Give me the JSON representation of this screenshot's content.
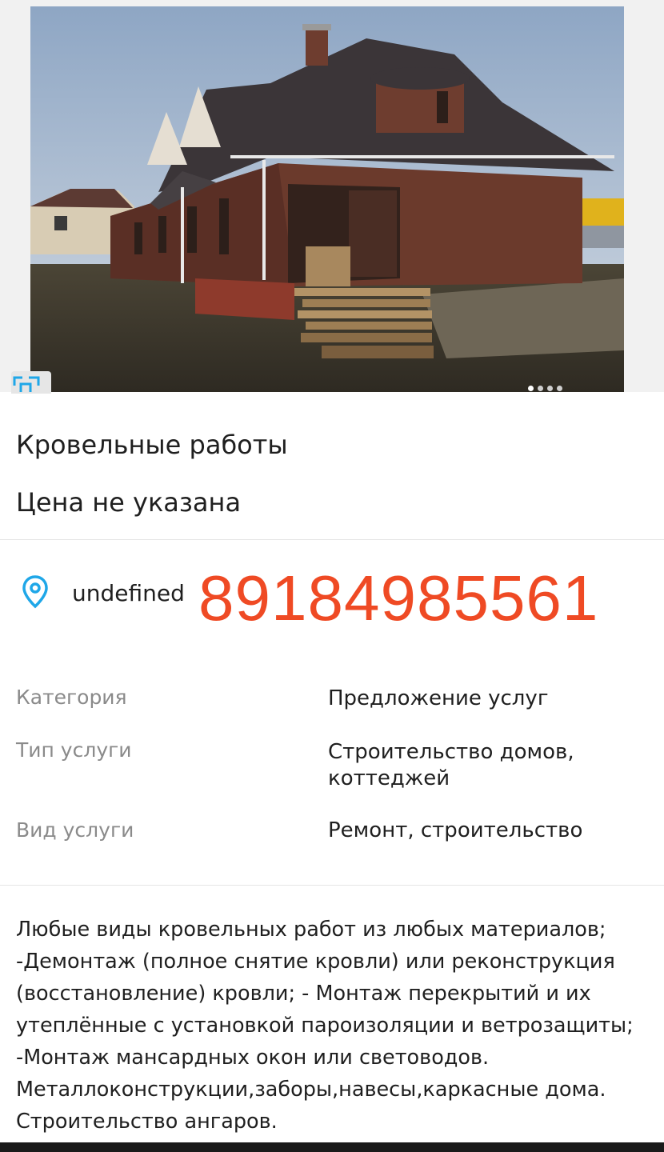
{
  "listing": {
    "title": "Кровельные работы",
    "price": "Цена не указана",
    "location": "undefined",
    "phone": "89184985561",
    "gallery": {
      "photo_count": 4,
      "active_index": 0
    }
  },
  "properties": [
    {
      "label": "Категория",
      "value": "Предложение услуг"
    },
    {
      "label": "Тип услуги",
      "value": "Строительство домов,\nкоттеджей"
    },
    {
      "label": "Вид услуги",
      "value": "Ремонт, строительство"
    }
  ],
  "description": " Любые виды кровельных работ из любых материалов;\n-Демонтаж (полное снятие кровли) или реконструкция\n(восстановление) кровли; - Монтаж перекрытий и их\nутеплённые с установкой пароизоляции и ветрозащиты;\n-Монтаж мансардных окон или световодов.\nМеталлоконструкции,заборы,навесы,каркасные дома.\nСтроительство ангаров.",
  "icons": {
    "location": "location-pin-icon",
    "expand": "expand-icon"
  },
  "colors": {
    "phone": "#ef4a24",
    "location_icon": "#1fa7e8",
    "expand_icon": "#1fa7e8"
  }
}
